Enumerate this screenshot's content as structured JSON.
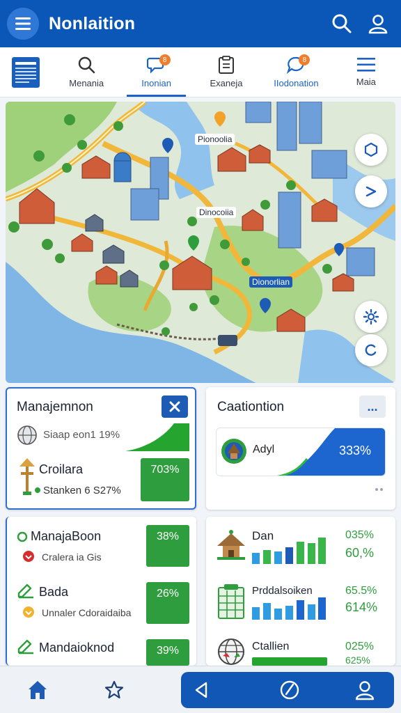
{
  "header": {
    "title": "Nonlaition"
  },
  "tabs": [
    {
      "label": "Menania",
      "icon": "search-icon"
    },
    {
      "label": "Inonian",
      "icon": "chat-pin-icon",
      "badge": "8"
    },
    {
      "label": "Exaneja",
      "icon": "clipboard-icon"
    },
    {
      "label": "IIodonation",
      "icon": "message-icon",
      "badge": "8"
    },
    {
      "label": "Maia",
      "icon": "menu-icon"
    }
  ],
  "map": {
    "labels": {
      "top": "Pionoolia",
      "center": "Dinocoiia",
      "right": "Dionorlian"
    }
  },
  "card1": {
    "title": "Manajemnon",
    "row1": "Siaap eon1 19%",
    "row2_title": "Croilara",
    "row2_sub": "Stanken 6 S27%",
    "box_value": "703%"
  },
  "card2": {
    "title": "Caationtion",
    "inner_label": "Adyl",
    "inner_value": "333%",
    "more": "..."
  },
  "card3": {
    "items": [
      {
        "title": "ManajaBoon",
        "sub": "Cralera ia Gis",
        "value": "38%"
      },
      {
        "title": "Bada",
        "sub": "Unnaler Cdoraidaiba",
        "value": "26%"
      },
      {
        "title": "Mandaioknod",
        "sub": "",
        "value": "39%"
      }
    ]
  },
  "card4": {
    "items": [
      {
        "title": "Dan",
        "pct1": "035%",
        "pct2": "60,%"
      },
      {
        "title": "Prddalsoiken",
        "pct1": "65.5%",
        "pct2": "614%"
      },
      {
        "title": "Ctallien",
        "pct1": "025%",
        "pct2": "625%"
      }
    ]
  },
  "colors": {
    "primary": "#0b57b8",
    "accent_green": "#2e9d3d",
    "badge_orange": "#ef7d2c"
  }
}
